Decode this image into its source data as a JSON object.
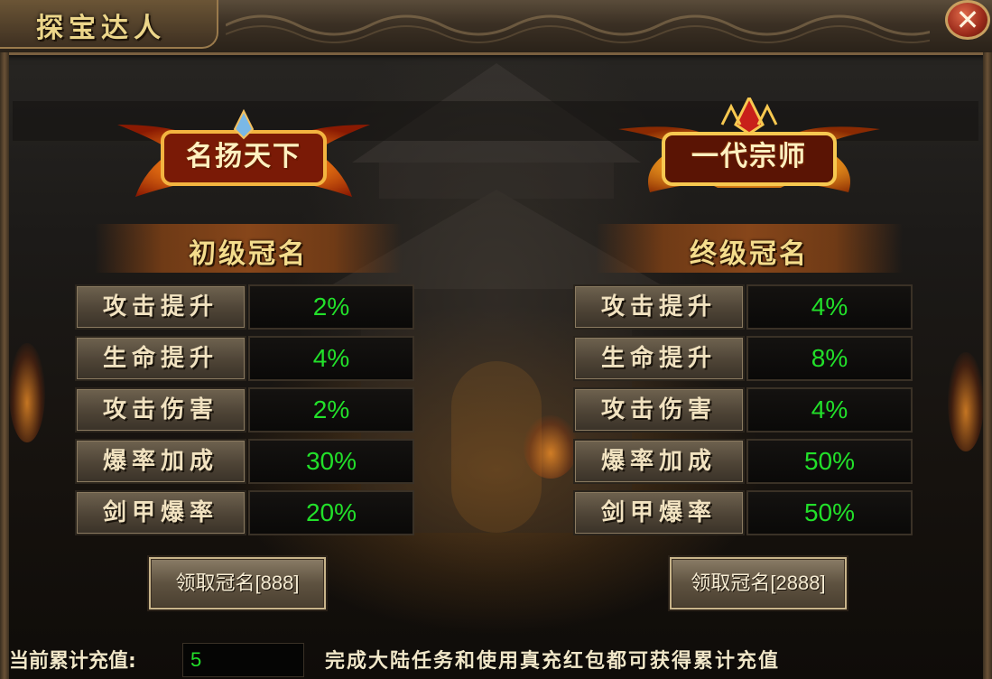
{
  "window": {
    "title": "探宝达人",
    "close_label": "✕"
  },
  "left_panel": {
    "emblem": "名扬天下",
    "rank_title": "初级冠名",
    "stats": [
      {
        "label": "攻击提升",
        "value": "2%"
      },
      {
        "label": "生命提升",
        "value": "4%"
      },
      {
        "label": "攻击伤害",
        "value": "2%"
      },
      {
        "label": "爆率加成",
        "value": "30%"
      },
      {
        "label": "剑甲爆率",
        "value": "20%"
      }
    ],
    "claim_button": "领取冠名[888]"
  },
  "right_panel": {
    "emblem": "一代宗师",
    "rank_title": "终级冠名",
    "stats": [
      {
        "label": "攻击提升",
        "value": "4%"
      },
      {
        "label": "生命提升",
        "value": "8%"
      },
      {
        "label": "攻击伤害",
        "value": "4%"
      },
      {
        "label": "爆率加成",
        "value": "50%"
      },
      {
        "label": "剑甲爆率",
        "value": "50%"
      }
    ],
    "claim_button": "领取冠名[2888]"
  },
  "footer": {
    "recharge_label": "当前累计充值:",
    "recharge_value": "5",
    "note": "完成大陆任务和使用真充红包都可获得累计充值"
  },
  "colors": {
    "value_green": "#22e02a",
    "title_gold": "#ecd68a",
    "close_red": "#9a2a1a"
  }
}
